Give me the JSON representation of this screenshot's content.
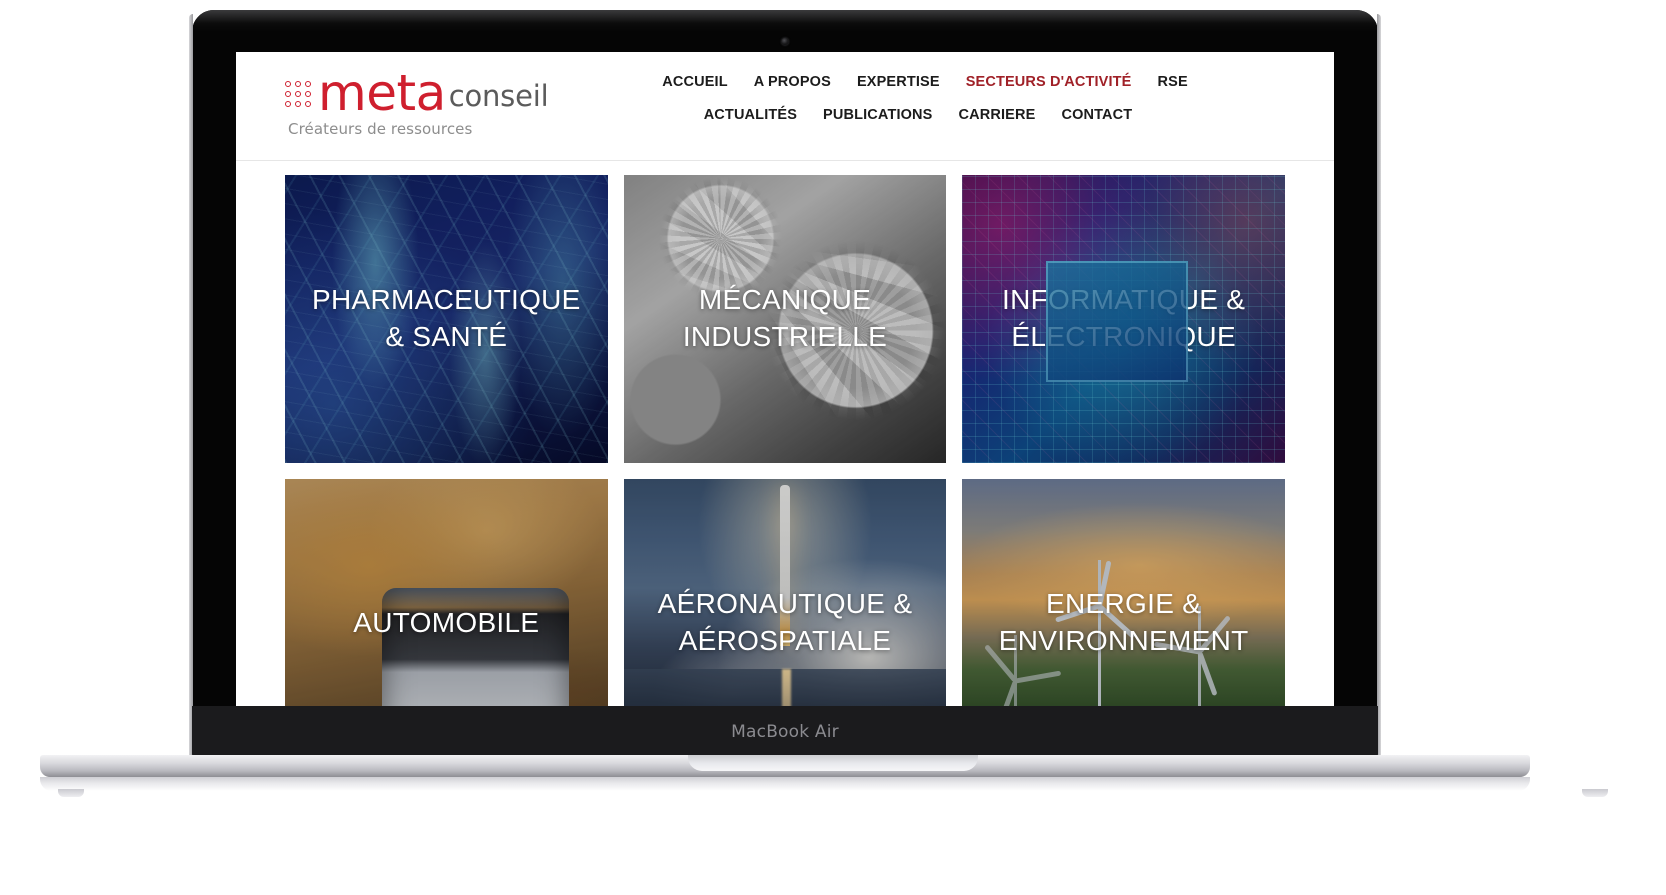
{
  "device": {
    "model_label": "MacBook Air"
  },
  "site": {
    "logo": {
      "brand_primary": "meta",
      "brand_secondary": "conseil",
      "tagline": "Créateurs de ressources",
      "dot_count": 9,
      "accent_color": "#cf1f2e"
    },
    "nav": {
      "active_color": "#a02128",
      "row1": [
        {
          "label": "ACCUEIL",
          "active": false
        },
        {
          "label": "A PROPOS",
          "active": false
        },
        {
          "label": "EXPERTISE",
          "active": false
        },
        {
          "label": "SECTEURS D'ACTIVITÉ",
          "active": true
        },
        {
          "label": "RSE",
          "active": false
        }
      ],
      "row2": [
        {
          "label": "ACTUALITÉS",
          "active": false
        },
        {
          "label": "PUBLICATIONS",
          "active": false
        },
        {
          "label": "CARRIERE",
          "active": false
        },
        {
          "label": "CONTACT",
          "active": false
        }
      ]
    },
    "sectors": [
      {
        "title": "PHARMACEUTIQUE\n& SANTÉ",
        "image": "dna-helix-photo"
      },
      {
        "title": "MÉCANIQUE\nINDUSTRIELLE",
        "image": "industrial-gears-photo"
      },
      {
        "title": "INFORMATIQUE &\nÉLECTRONIQUE",
        "image": "circuit-board-photo"
      },
      {
        "title": "AUTOMOBILE",
        "image": "rally-car-photo"
      },
      {
        "title": "AÉRONAUTIQUE &\nAÉROSPATIALE",
        "image": "rocket-launch-photo"
      },
      {
        "title": "ENERGIE &\nENVIRONNEMENT",
        "image": "wind-turbines-photo"
      }
    ]
  }
}
